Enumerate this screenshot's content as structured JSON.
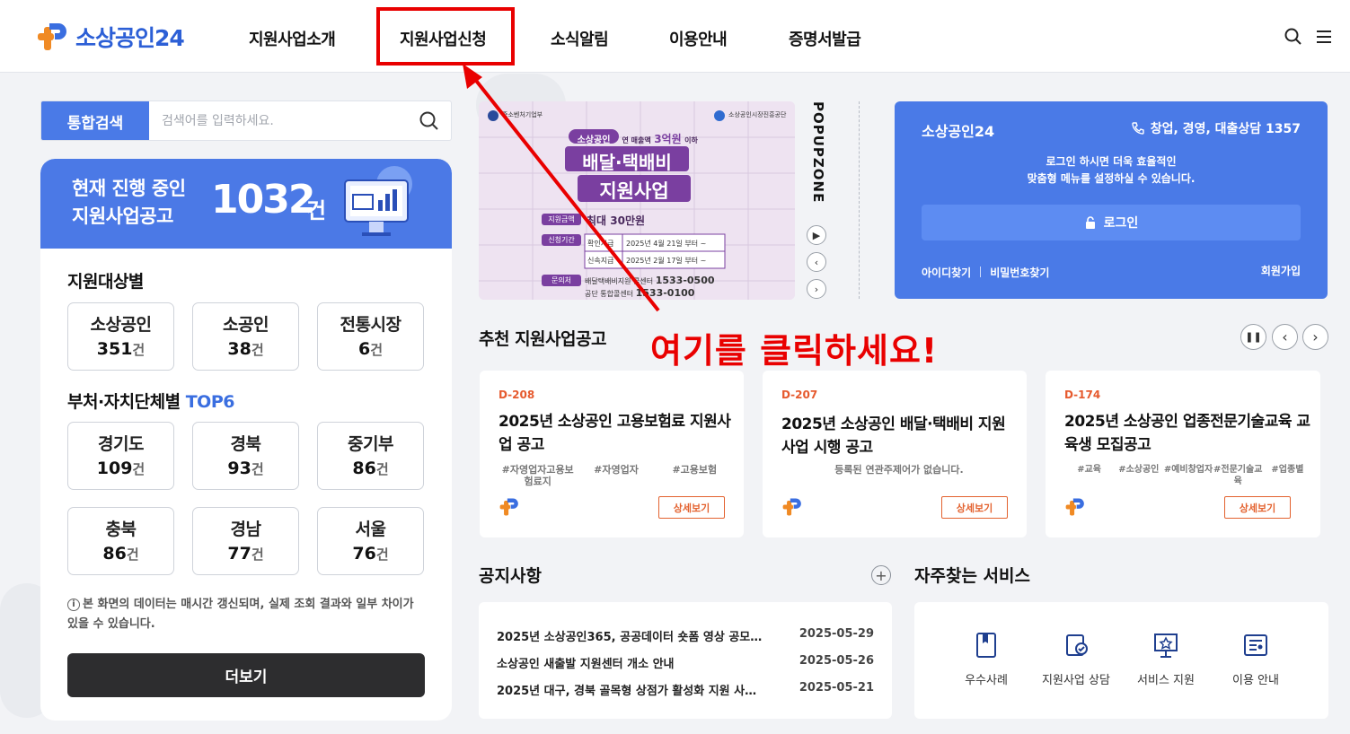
{
  "header": {
    "logo_text": "소상공인24",
    "nav": [
      "지원사업소개",
      "지원사업신청",
      "소식알림",
      "이용안내",
      "증명서발급"
    ],
    "highlighted_nav_index": 1
  },
  "search": {
    "button_label": "통합검색",
    "placeholder": "검색어를 입력하세요."
  },
  "summary": {
    "title_line1": "현재 진행 중인",
    "title_line2": "지원사업공고",
    "count": "1032",
    "unit": "건",
    "target_title": "지원대상별",
    "targets": [
      {
        "label": "소상공인",
        "count": "351"
      },
      {
        "label": "소공인",
        "count": "38"
      },
      {
        "label": "전통시장",
        "count": "6"
      }
    ],
    "region_title": "부처·자치단체별",
    "region_accent": "TOP6",
    "regions": [
      {
        "label": "경기도",
        "count": "109"
      },
      {
        "label": "경북",
        "count": "93"
      },
      {
        "label": "중기부",
        "count": "86"
      },
      {
        "label": "충북",
        "count": "86"
      },
      {
        "label": "경남",
        "count": "77"
      },
      {
        "label": "서울",
        "count": "76"
      }
    ],
    "count_unit": "건",
    "notice": "본 화면의 데이터는 매시간 갱신되며, 실제 조회 결과와 일부 차이가 있을 수 있습니다.",
    "more_label": "더보기"
  },
  "banner": {
    "ministry": "중소벤처기업부",
    "agency": "소상공인시장진흥공단",
    "tag": "소상공인",
    "tag_rest_a": "연 매출액",
    "tag_amount": "3억원",
    "tag_rest_b": "이하",
    "headline1": "배달·택배비",
    "headline2": "지원사업",
    "amount_label": "지원금액",
    "amount_value": "최대 30만원",
    "period_label": "신청기간",
    "period_row1_type": "확인지급",
    "period_row1_date": "2025년 4월 21일 부터 ~",
    "period_row2_type": "신속지급",
    "period_row2_date": "2025년 2월 17일 부터 ~",
    "contact_label": "문의처",
    "contact1_name": "배달택배비지원 콜센터",
    "contact1_phone": "1533-0500",
    "contact2_name": "공단 통합콜센터",
    "contact2_phone": "1533-0100",
    "side_label": "POPUPZONE"
  },
  "login": {
    "title": "소상공인24",
    "phone": "창업, 경영, 대출상담 1357",
    "message_line1": "로그인 하시면 더욱 효율적인",
    "message_line2": "맞춤형 메뉴를 설정하실 수 있습니다.",
    "login_label": "로그인",
    "find_id": "아이디찾기",
    "find_pw": "비밀번호찾기",
    "join": "회원가입"
  },
  "recommended": {
    "title": "추천 지원사업공고",
    "detail_label": "상세보기",
    "cards": [
      {
        "dday": "D-208",
        "title": "2025년 소상공인 고용보험료 지원사업 공고",
        "tags": [
          "#자영업자고용보험료지",
          "#자영업자",
          "#고용보험"
        ]
      },
      {
        "dday": "D-207",
        "title": "2025년 소상공인 배달·택배비 지원 사업 시행 공고",
        "tags": [
          "등록된 연관주제어가 없습니다."
        ]
      },
      {
        "dday": "D-174",
        "title": "2025년 소상공인 업종전문기술교육 교육생 모집공고",
        "tags": [
          "#교육",
          "#소상공인",
          "#예비창업자",
          "#전문기술교육",
          "#업종별"
        ]
      }
    ]
  },
  "annotation": {
    "click_text": "여기를 클릭하세요!",
    "color": "#e90000"
  },
  "notices": {
    "title": "공지사항",
    "items": [
      {
        "title": "2025년 소상공인365, 공공데이터 숏폼 영상 공모…",
        "date": "2025-05-29"
      },
      {
        "title": "소상공인 새출발 지원센터 개소 안내",
        "date": "2025-05-26"
      },
      {
        "title": "2025년 대구, 경북 골목형 상점가 활성화 지원 사…",
        "date": "2025-05-21"
      }
    ]
  },
  "services": {
    "title": "자주찾는 서비스",
    "items": [
      {
        "label": "우수사례",
        "icon": "bookmark-book-icon"
      },
      {
        "label": "지원사업 상담",
        "icon": "consult-icon"
      },
      {
        "label": "서비스 지원",
        "icon": "presentation-icon"
      },
      {
        "label": "이용 안내",
        "icon": "document-icon"
      }
    ]
  },
  "colors": {
    "brand_blue": "#4a7ae7",
    "orange": "#f08a24",
    "dday": "#e65a2e"
  }
}
